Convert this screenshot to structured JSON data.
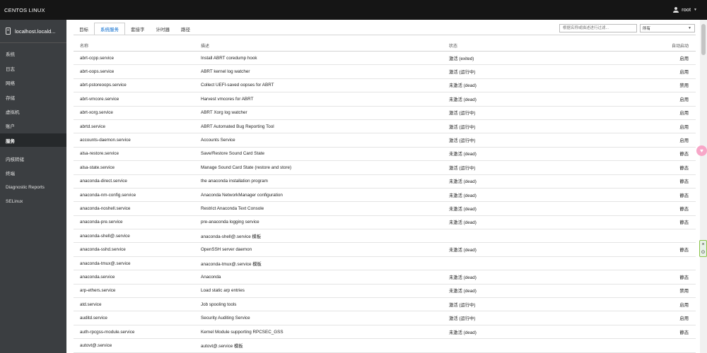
{
  "topbar": {
    "brand": "CENTOS LINUX",
    "user": "root"
  },
  "sidebar": {
    "host": "localhost.locald...",
    "items": [
      {
        "label": "系统",
        "active": false
      },
      {
        "label": "日志",
        "active": false
      },
      {
        "label": "网络",
        "active": false
      },
      {
        "label": "存储",
        "active": false
      },
      {
        "label": "虚拟机",
        "active": false
      },
      {
        "label": "账户",
        "active": false
      },
      {
        "label": "服务",
        "active": true
      },
      {
        "label": "内核转储",
        "active": false
      },
      {
        "label": "终端",
        "active": false
      },
      {
        "label": "Diagnostic Reports",
        "active": false
      },
      {
        "label": "SELinux",
        "active": false
      }
    ]
  },
  "tabs": [
    "目标",
    "系统服务",
    "套接字",
    "计时器",
    "路径"
  ],
  "filter": {
    "placeholder": "根据名称或描述进行过滤..."
  },
  "select": {
    "value": "所有"
  },
  "table": {
    "headers": {
      "name": "名称",
      "description": "描述",
      "state": "状态",
      "auto": "自动启动"
    },
    "rows": [
      {
        "name": "abrt-ccpp.service",
        "description": "Install ABRT coredump hook",
        "state": "激活 (exited)",
        "auto": "启用"
      },
      {
        "name": "abrt-oops.service",
        "description": "ABRT kernel log watcher",
        "state": "激活 (运行中)",
        "auto": "启用"
      },
      {
        "name": "abrt-pstoreoops.service",
        "description": "Collect UEFI-saved oopses for ABRT",
        "state": "未激活 (dead)",
        "auto": "禁用"
      },
      {
        "name": "abrt-vmcore.service",
        "description": "Harvest vmcores for ABRT",
        "state": "未激活 (dead)",
        "auto": "启用"
      },
      {
        "name": "abrt-xorg.service",
        "description": "ABRT Xorg log watcher",
        "state": "激活 (运行中)",
        "auto": "启用"
      },
      {
        "name": "abrtd.service",
        "description": "ABRT Automated Bug Reporting Tool",
        "state": "激活 (运行中)",
        "auto": "启用"
      },
      {
        "name": "accounts-daemon.service",
        "description": "Accounts Service",
        "state": "激活 (运行中)",
        "auto": "启用"
      },
      {
        "name": "alsa-restore.service",
        "description": "Save/Restore Sound Card State",
        "state": "未激活 (dead)",
        "auto": "静态"
      },
      {
        "name": "alsa-state.service",
        "description": "Manage Sound Card State (restore and store)",
        "state": "激活 (运行中)",
        "auto": "静态"
      },
      {
        "name": "anaconda-direct.service",
        "description": "the anaconda installation program",
        "state": "未激活 (dead)",
        "auto": "静态"
      },
      {
        "name": "anaconda-nm-config.service",
        "description": "Anaconda NetworkManager configuration",
        "state": "未激活 (dead)",
        "auto": "静态"
      },
      {
        "name": "anaconda-noshell.service",
        "description": "Restrict Anaconda Text Console",
        "state": "未激活 (dead)",
        "auto": "静态"
      },
      {
        "name": "anaconda-pre.service",
        "description": "pre-anaconda logging service",
        "state": "未激活 (dead)",
        "auto": "静态"
      },
      {
        "name": "anaconda-shell@.service",
        "description": "anaconda-shell@.service 模板",
        "state": "",
        "auto": ""
      },
      {
        "name": "anaconda-sshd.service",
        "description": "OpenSSH server daemon",
        "state": "未激活 (dead)",
        "auto": "静态"
      },
      {
        "name": "anaconda-tmux@.service",
        "description": "anaconda-tmux@.service 模板",
        "state": "",
        "auto": ""
      },
      {
        "name": "anaconda.service",
        "description": "Anaconda",
        "state": "未激活 (dead)",
        "auto": "静态"
      },
      {
        "name": "arp-ethers.service",
        "description": "Load static arp entries",
        "state": "未激活 (dead)",
        "auto": "禁用"
      },
      {
        "name": "atd.service",
        "description": "Job spooling tools",
        "state": "激活 (运行中)",
        "auto": "启用"
      },
      {
        "name": "auditd.service",
        "description": "Security Auditing Service",
        "state": "激活 (运行中)",
        "auto": "启用"
      },
      {
        "name": "auth-rpcgss-module.service",
        "description": "Kernel Module supporting RPCSEC_GSS",
        "state": "未激活 (dead)",
        "auto": "静态"
      },
      {
        "name": "autovt@.service",
        "description": "autovt@.service 模板",
        "state": "",
        "auto": ""
      }
    ]
  },
  "widgets": {
    "side_close": "×",
    "side_arrow": "⊙"
  }
}
